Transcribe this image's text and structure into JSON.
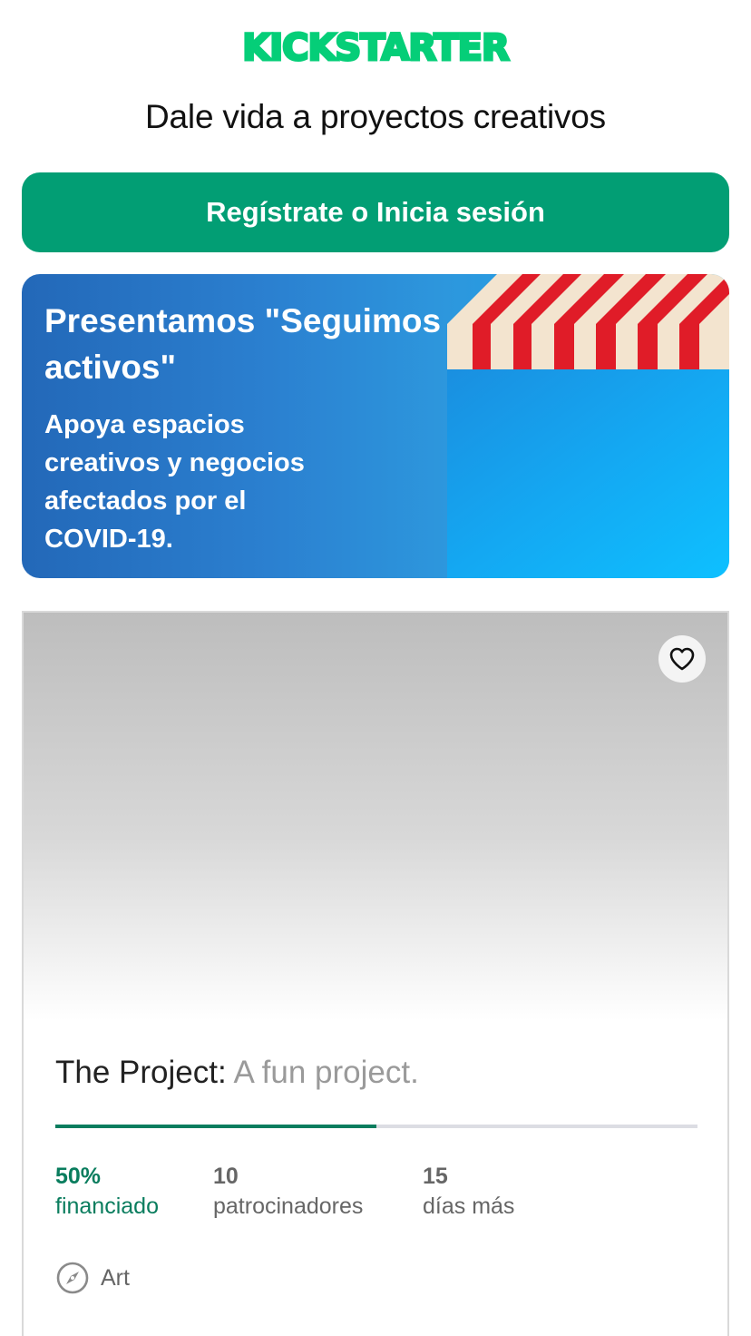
{
  "header": {
    "logo_text": "KICKSTARTER",
    "tagline": "Dale vida a proyectos creativos"
  },
  "cta": {
    "label": "Regístrate o Inicia sesión"
  },
  "banner": {
    "title": "Presentamos \"Seguimos activos\"",
    "body": "Apoya espacios creativos y negocios afectados por el COVID-19."
  },
  "project": {
    "name": "The Project:",
    "blurb": "A fun project.",
    "progress_percent": 50,
    "funded_value": "50%",
    "funded_label": "financiado",
    "backers_value": "10",
    "backers_label": "patrocinadores",
    "days_value": "15",
    "days_label": "días más",
    "category": "Art",
    "category_icon": "compass-icon",
    "favorite_icon": "heart-icon"
  },
  "colors": {
    "brand_green": "#029e74",
    "progress_green": "#0a7d5e",
    "banner_blue": "#2b80d0"
  }
}
